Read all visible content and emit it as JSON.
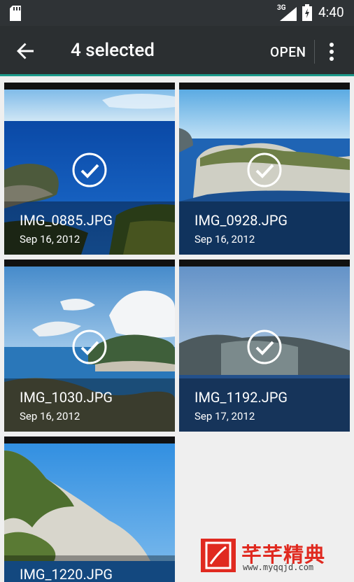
{
  "status_bar": {
    "network": "3G",
    "time": "4:40"
  },
  "action_bar": {
    "title": "4 selected",
    "open_label": "OPEN",
    "back_icon": "arrow-back-icon",
    "overflow_icon": "more-vert-icon"
  },
  "photos": [
    {
      "filename": "IMG_0885.JPG",
      "date": "Sep 16, 2012",
      "selected": true
    },
    {
      "filename": "IMG_0928.JPG",
      "date": "Sep 16, 2012",
      "selected": true
    },
    {
      "filename": "IMG_1030.JPG",
      "date": "Sep 16, 2012",
      "selected": true
    },
    {
      "filename": "IMG_1192.JPG",
      "date": "Sep 17, 2012",
      "selected": true
    },
    {
      "filename": "IMG_1220.JPG",
      "date": "",
      "selected": false
    }
  ],
  "watermark": {
    "text": "芊芊精典",
    "url": "www.myqqjd.com"
  },
  "colors": {
    "status_bar": "#2f3336",
    "action_bar": "#2b2f31",
    "accent_underline": "#1d9a8a",
    "grid_background": "#efefef",
    "watermark_red": "#e02a20"
  }
}
